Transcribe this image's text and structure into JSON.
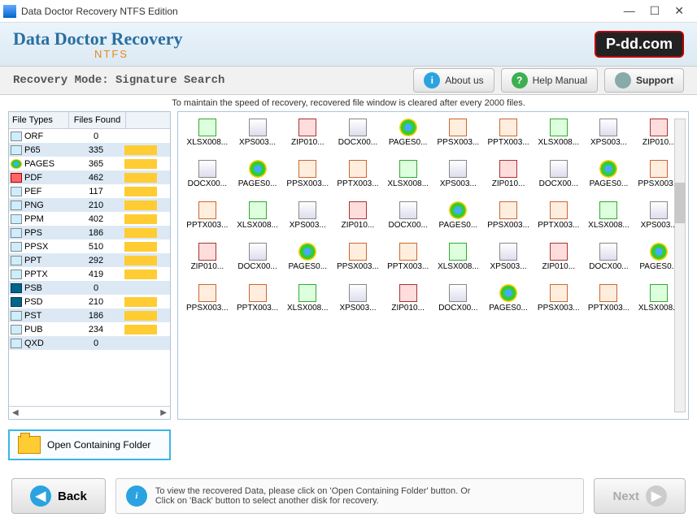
{
  "window": {
    "title": "Data Doctor Recovery NTFS Edition"
  },
  "header": {
    "brand": "Data Doctor Recovery",
    "sub": "NTFS",
    "logo": "P-dd.com"
  },
  "modebar": {
    "mode": "Recovery Mode: Signature Search",
    "about": "About us",
    "help": "Help Manual",
    "support": "Support"
  },
  "info": "To maintain the speed of recovery, recovered file window is cleared after every 2000 files.",
  "list": {
    "h1": "File Types",
    "h2": "Files Found",
    "rows": [
      {
        "t": "ORF",
        "n": 0,
        "bar": 0
      },
      {
        "t": "P65",
        "n": 335,
        "bar": 1,
        "sel": 1
      },
      {
        "t": "PAGES",
        "n": 365,
        "bar": 1,
        "chr": 1
      },
      {
        "t": "PDF",
        "n": 462,
        "bar": 1,
        "sel": 1,
        "red": 1
      },
      {
        "t": "PEF",
        "n": 117,
        "bar": 1
      },
      {
        "t": "PNG",
        "n": 210,
        "bar": 1,
        "sel": 1
      },
      {
        "t": "PPM",
        "n": 402,
        "bar": 1
      },
      {
        "t": "PPS",
        "n": 186,
        "bar": 1,
        "sel": 1
      },
      {
        "t": "PPSX",
        "n": 510,
        "bar": 1
      },
      {
        "t": "PPT",
        "n": 292,
        "bar": 1,
        "sel": 1
      },
      {
        "t": "PPTX",
        "n": 419,
        "bar": 1
      },
      {
        "t": "PSB",
        "n": 0,
        "bar": 0,
        "sel": 1,
        "ps": 1
      },
      {
        "t": "PSD",
        "n": 210,
        "bar": 1,
        "ps": 1
      },
      {
        "t": "PST",
        "n": 186,
        "bar": 1,
        "sel": 1
      },
      {
        "t": "PUB",
        "n": 234,
        "bar": 1
      },
      {
        "t": "QXD",
        "n": 0,
        "bar": 0,
        "sel": 1
      }
    ]
  },
  "openFolder": "Open Containing Folder",
  "files": [
    [
      {
        "n": "XLSX008...",
        "c": "xls"
      },
      {
        "n": "XPS003...",
        "c": "doc"
      },
      {
        "n": "ZIP010...",
        "c": "zip"
      },
      {
        "n": "DOCX00...",
        "c": "doc"
      },
      {
        "n": "PAGES0...",
        "c": "chr"
      },
      {
        "n": "PPSX003...",
        "c": "ppt"
      },
      {
        "n": "PPTX003...",
        "c": "ppt"
      },
      {
        "n": "XLSX008...",
        "c": "xls"
      },
      {
        "n": "XPS003...",
        "c": "doc"
      },
      {
        "n": "ZIP010...",
        "c": "zip"
      }
    ],
    [
      {
        "n": "DOCX00...",
        "c": "doc"
      },
      {
        "n": "PAGES0...",
        "c": "chr"
      },
      {
        "n": "PPSX003...",
        "c": "ppt"
      },
      {
        "n": "PPTX003...",
        "c": "ppt"
      },
      {
        "n": "XLSX008...",
        "c": "xls"
      },
      {
        "n": "XPS003...",
        "c": "doc"
      },
      {
        "n": "ZIP010...",
        "c": "zip"
      },
      {
        "n": "DOCX00...",
        "c": "doc"
      },
      {
        "n": "PAGES0...",
        "c": "chr"
      },
      {
        "n": "PPSX003...",
        "c": "ppt"
      }
    ],
    [
      {
        "n": "PPTX003...",
        "c": "ppt"
      },
      {
        "n": "XLSX008...",
        "c": "xls"
      },
      {
        "n": "XPS003...",
        "c": "doc"
      },
      {
        "n": "ZIP010...",
        "c": "zip"
      },
      {
        "n": "DOCX00...",
        "c": "doc"
      },
      {
        "n": "PAGES0...",
        "c": "chr"
      },
      {
        "n": "PPSX003...",
        "c": "ppt"
      },
      {
        "n": "PPTX003...",
        "c": "ppt"
      },
      {
        "n": "XLSX008...",
        "c": "xls"
      },
      {
        "n": "XPS003...",
        "c": "doc"
      }
    ],
    [
      {
        "n": "ZIP010...",
        "c": "zip"
      },
      {
        "n": "DOCX00...",
        "c": "doc"
      },
      {
        "n": "PAGES0...",
        "c": "chr"
      },
      {
        "n": "PPSX003...",
        "c": "ppt"
      },
      {
        "n": "PPTX003...",
        "c": "ppt"
      },
      {
        "n": "XLSX008...",
        "c": "xls"
      },
      {
        "n": "XPS003...",
        "c": "doc"
      },
      {
        "n": "ZIP010...",
        "c": "zip"
      },
      {
        "n": "DOCX00...",
        "c": "doc"
      },
      {
        "n": "PAGES0...",
        "c": "chr"
      }
    ],
    [
      {
        "n": "PPSX003...",
        "c": "ppt"
      },
      {
        "n": "PPTX003...",
        "c": "ppt"
      },
      {
        "n": "XLSX008...",
        "c": "xls"
      },
      {
        "n": "XPS003...",
        "c": "doc"
      },
      {
        "n": "ZIP010...",
        "c": "zip"
      },
      {
        "n": "DOCX00...",
        "c": "doc"
      },
      {
        "n": "PAGES0...",
        "c": "chr"
      },
      {
        "n": "PPSX003...",
        "c": "ppt"
      },
      {
        "n": "PPTX003...",
        "c": "ppt"
      },
      {
        "n": "XLSX008...",
        "c": "xls"
      }
    ]
  ],
  "footer": {
    "back": "Back",
    "next": "Next",
    "hint1": "To view the recovered Data, please click on 'Open Containing Folder' button. Or",
    "hint2": "Click on 'Back' button to select another disk for recovery."
  }
}
